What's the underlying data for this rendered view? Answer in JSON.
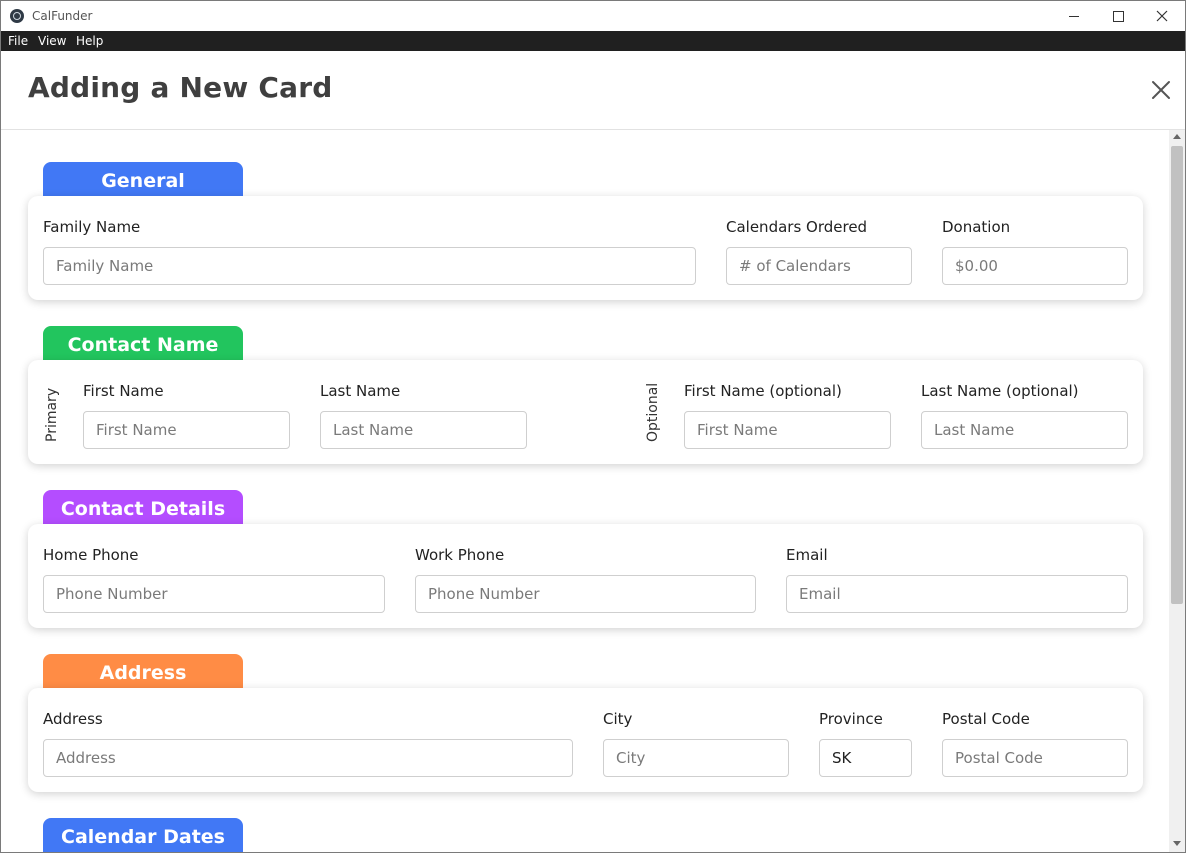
{
  "window": {
    "title": "CalFunder"
  },
  "menu": [
    "File",
    "View",
    "Help"
  ],
  "header": {
    "title": "Adding a New Card"
  },
  "colors": {
    "general": "#4178f5",
    "contact_name": "#22c55e",
    "contact_details": "#b44dff",
    "address": "#ff8c45",
    "calendar_dates": "#4178f5"
  },
  "general": {
    "tab": "General",
    "family_name": {
      "label": "Family Name",
      "placeholder": "Family Name"
    },
    "calendars_ordered": {
      "label": "Calendars Ordered",
      "placeholder": "# of Calendars"
    },
    "donation": {
      "label": "Donation",
      "placeholder": "$0.00"
    }
  },
  "contact_name": {
    "tab": "Contact Name",
    "primary_label": "Primary",
    "optional_label": "Optional",
    "primary_first": {
      "label": "First Name",
      "placeholder": "First Name"
    },
    "primary_last": {
      "label": "Last Name",
      "placeholder": "Last Name"
    },
    "optional_first": {
      "label": "First Name (optional)",
      "placeholder": "First Name"
    },
    "optional_last": {
      "label": "Last Name (optional)",
      "placeholder": "Last Name"
    }
  },
  "contact_details": {
    "tab": "Contact Details",
    "home_phone": {
      "label": "Home Phone",
      "placeholder": "Phone Number"
    },
    "work_phone": {
      "label": "Work Phone",
      "placeholder": "Phone Number"
    },
    "email": {
      "label": "Email",
      "placeholder": "Email"
    }
  },
  "address": {
    "tab": "Address",
    "address": {
      "label": "Address",
      "placeholder": "Address"
    },
    "city": {
      "label": "City",
      "placeholder": "City"
    },
    "province": {
      "label": "Province",
      "value": "SK"
    },
    "postal_code": {
      "label": "Postal Code",
      "placeholder": "Postal Code"
    }
  },
  "calendar_dates": {
    "tab": "Calendar Dates"
  }
}
